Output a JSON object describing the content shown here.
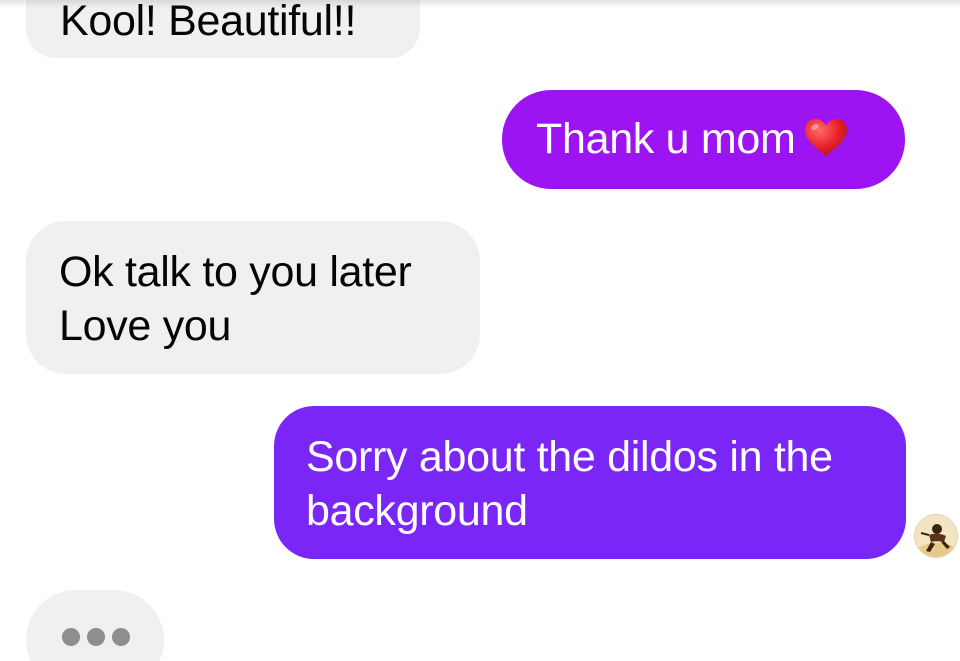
{
  "conversation": {
    "messages": [
      {
        "direction": "incoming",
        "lines": [
          "Kool!  Beautiful!!"
        ]
      },
      {
        "direction": "outgoing",
        "lines": [
          "Thank u mom"
        ],
        "emoji": "red-heart-icon"
      },
      {
        "direction": "incoming",
        "lines": [
          "Ok talk to you later",
          "Love you"
        ]
      },
      {
        "direction": "outgoing",
        "lines": [
          "Sorry about the dildos in the",
          "background"
        ]
      }
    ],
    "typing_indicator": {
      "icon": "typing-dots-icon"
    }
  },
  "colors": {
    "incoming_bubble": "#f0f0f0",
    "outgoing_bubble_top": "#9d14f2",
    "outgoing_bubble_bottom": "#7a26f7",
    "text_dark": "#050505",
    "text_light": "#ffffff"
  }
}
